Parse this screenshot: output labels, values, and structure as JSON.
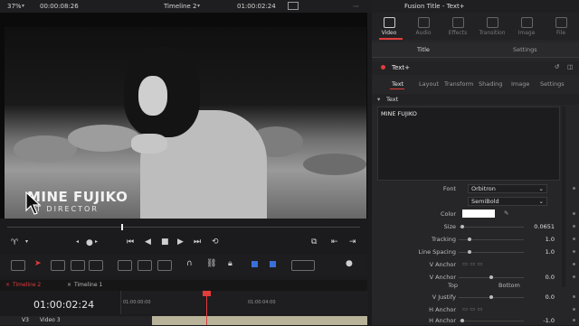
{
  "topbar": {
    "zoom": "37%",
    "source_timecode": "00:00:08:26",
    "timeline_name": "Timeline 2",
    "record_timecode": "01:00:02:24",
    "inspector_title": "Fusion Title - Text+"
  },
  "viewer": {
    "overlay_title": "MINE FUJIKO",
    "overlay_subtitle": "T DIRECTOR"
  },
  "timeline": {
    "tab1": "Timeline 2",
    "tab2": "Timeline 1",
    "timecode": "01:00:02:24",
    "ruler_start": "01:00:00:00",
    "ruler_mid": "01:00:04:00",
    "track_label": "V3",
    "track_name": "Video 3"
  },
  "inspector": {
    "top_tabs": [
      "Video",
      "Audio",
      "Effects",
      "Transition",
      "Image",
      "File"
    ],
    "subtabs_main": [
      "Title",
      "Settings"
    ],
    "node_name": "Text+",
    "subtabs": [
      "Text",
      "Layout",
      "Transform",
      "Shading",
      "Image",
      "Settings"
    ],
    "section": "Text",
    "text_value": "MINE FUJIKO",
    "font_label": "Font",
    "font_value": "Orbitron",
    "style_value": "SemiBold",
    "color_label": "Color",
    "size_label": "Size",
    "size_value": "0.0651",
    "tracking_label": "Tracking",
    "tracking_value": "1.0",
    "line_spacing_label": "Line Spacing",
    "line_spacing_value": "1.0",
    "v_anchor_label": "V Anchor",
    "v_anchor2_label": "V Anchor",
    "v_anchor2_value": "0.0",
    "top_label": "Top",
    "bottom_label": "Bottom",
    "v_justify_label": "V Justify",
    "v_justify_value": "0.0",
    "h_anchor_label": "H Anchor",
    "h_anchor2_label": "H Anchor",
    "h_anchor2_value": "-1.0"
  },
  "colors": {
    "accent_red": "#e23c3c",
    "clip": "#b9b39a",
    "text_color_swatch": "#ffffff"
  }
}
